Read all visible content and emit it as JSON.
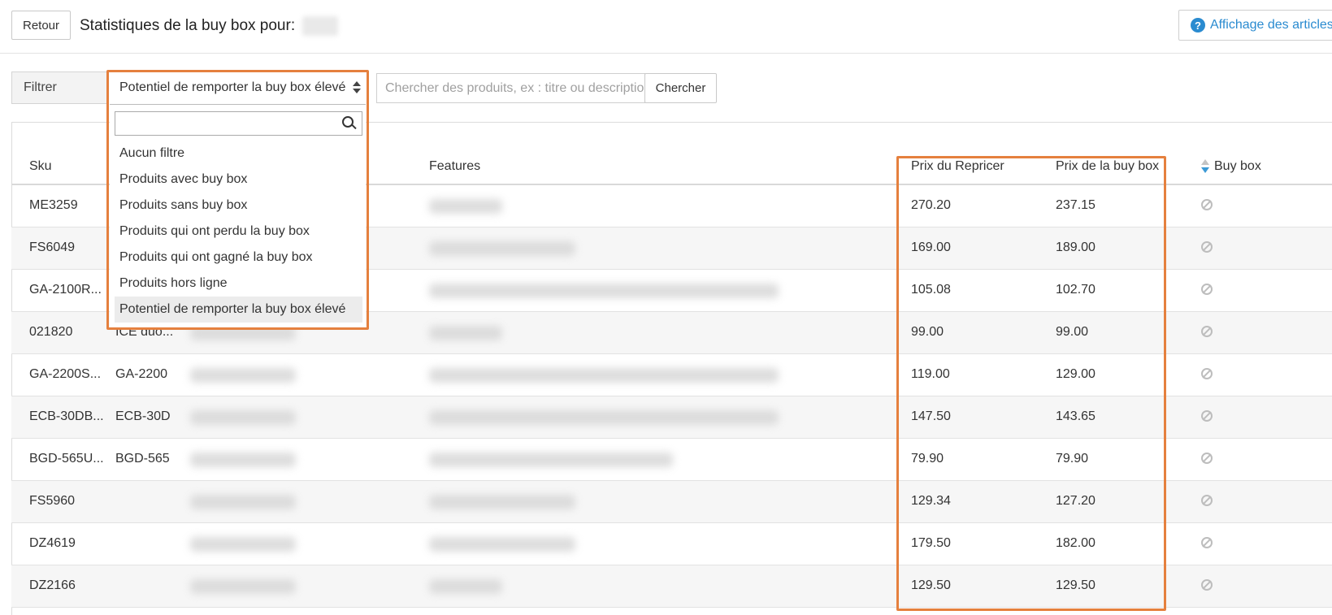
{
  "header": {
    "back_label": "Retour",
    "title": "Statistiques de la buy box pour:",
    "articles_label": "Affichage des articles",
    "help_icon": "?"
  },
  "filter": {
    "label": "Filtrer",
    "selected": "Potentiel de remporter la buy box élevé",
    "search_placeholder": "Chercher des produits, ex : titre ou description",
    "search_button": "Chercher",
    "options": [
      "Aucun filtre",
      "Produits avec buy box",
      "Produits sans buy box",
      "Produits qui ont perdu la buy box",
      "Produits qui ont gagné la buy box",
      "Produits hors ligne",
      "Potentiel de remporter la buy box élevé"
    ]
  },
  "table": {
    "columns": {
      "sku": "Sku",
      "features": "Features",
      "repricer_price": "Prix du Repricer",
      "buybox_price": "Prix de la buy box",
      "buybox": "Buy box"
    },
    "rows": [
      {
        "sku": "ME3259",
        "model": "",
        "repricer": "270.20",
        "buybox": "237.15"
      },
      {
        "sku": "FS6049",
        "model": "",
        "repricer": "169.00",
        "buybox": "189.00"
      },
      {
        "sku": "GA-2100R...",
        "model": "",
        "repricer": "105.08",
        "buybox": "102.70"
      },
      {
        "sku": "021820",
        "model": "ICE duo...",
        "repricer": "99.00",
        "buybox": "99.00"
      },
      {
        "sku": "GA-2200S...",
        "model": "GA-2200",
        "repricer": "119.00",
        "buybox": "129.00"
      },
      {
        "sku": "ECB-30DB...",
        "model": "ECB-30D",
        "repricer": "147.50",
        "buybox": "143.65"
      },
      {
        "sku": "BGD-565U...",
        "model": "BGD-565",
        "repricer": "79.90",
        "buybox": "79.90"
      },
      {
        "sku": "FS5960",
        "model": "",
        "repricer": "129.34",
        "buybox": "127.20"
      },
      {
        "sku": "DZ4619",
        "model": "",
        "repricer": "179.50",
        "buybox": "182.00"
      },
      {
        "sku": "DZ2166",
        "model": "",
        "repricer": "129.50",
        "buybox": "129.50"
      }
    ]
  },
  "colors": {
    "highlight": "#e5803e",
    "accent": "#2a8bd0"
  }
}
